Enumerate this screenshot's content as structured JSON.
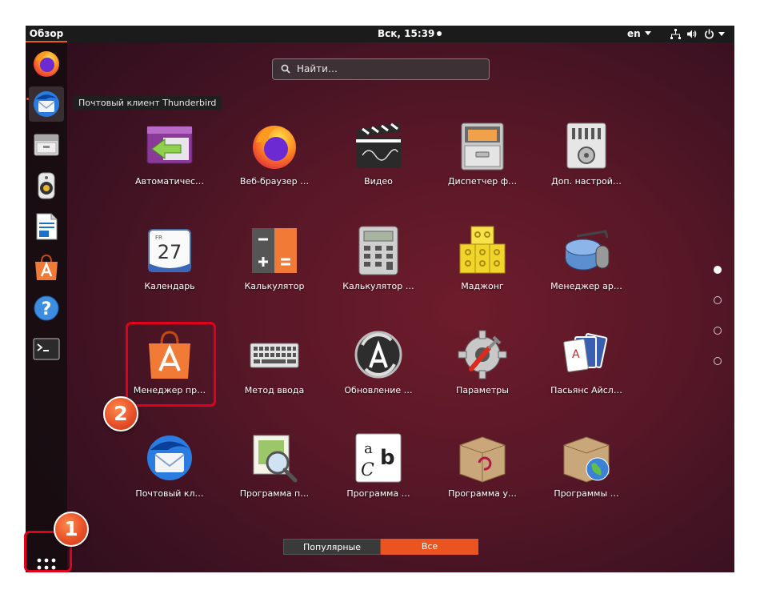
{
  "topbar": {
    "overview": "Обзор",
    "clock": "Вск, 15:39",
    "lang": "en"
  },
  "tray_icons": [
    "network-icon",
    "volume-icon",
    "power-icon"
  ],
  "dock": {
    "items": [
      "firefox-icon",
      "thunderbird-icon",
      "file-manager-icon",
      "rhythmbox-icon",
      "libreoffice-writer-icon",
      "software-center-icon",
      "help-icon",
      "terminal-icon"
    ],
    "tooltip": "Почтовый клиент Thunderbird"
  },
  "search": {
    "placeholder": "Найти…"
  },
  "apps": [
    {
      "label": "Автоматичес…",
      "icon": "startup-apps-icon"
    },
    {
      "label": "Веб-браузер …",
      "icon": "firefox-icon"
    },
    {
      "label": "Видео",
      "icon": "video-icon"
    },
    {
      "label": "Диспетчер ф…",
      "icon": "file-cabinet-icon"
    },
    {
      "label": "Доп. настрой…",
      "icon": "tweaks-icon"
    },
    {
      "label": "Календарь",
      "icon": "calendar-icon"
    },
    {
      "label": "Калькулятор",
      "icon": "calculator-icon"
    },
    {
      "label": "Калькулятор …",
      "icon": "calculator-legacy-icon"
    },
    {
      "label": "Маджонг",
      "icon": "mahjong-icon"
    },
    {
      "label": "Менеджер ар…",
      "icon": "archive-manager-icon"
    },
    {
      "label": "Менеджер пр…",
      "icon": "software-center-icon"
    },
    {
      "label": "Метод ввода",
      "icon": "keyboard-icon"
    },
    {
      "label": "Обновление …",
      "icon": "software-update-icon"
    },
    {
      "label": "Параметры",
      "icon": "settings-icon"
    },
    {
      "label": "Пасьянс Айсл…",
      "icon": "cards-icon"
    },
    {
      "label": "Почтовый кл…",
      "icon": "thunderbird-icon"
    },
    {
      "label": "Программа п…",
      "icon": "image-viewer-icon"
    },
    {
      "label": "Программа …",
      "icon": "font-viewer-icon"
    },
    {
      "label": "Программа у…",
      "icon": "package-installer-icon"
    },
    {
      "label": "Программы …",
      "icon": "software-sources-icon"
    }
  ],
  "page_indicator": {
    "pages": 4,
    "current": 1
  },
  "tabs": {
    "popular": "Популярные",
    "all": "Все",
    "active": "Все"
  },
  "annotations": {
    "badge1": "1",
    "badge2": "2",
    "color": "#e0001b"
  },
  "colors": {
    "accent": "#e95420"
  }
}
